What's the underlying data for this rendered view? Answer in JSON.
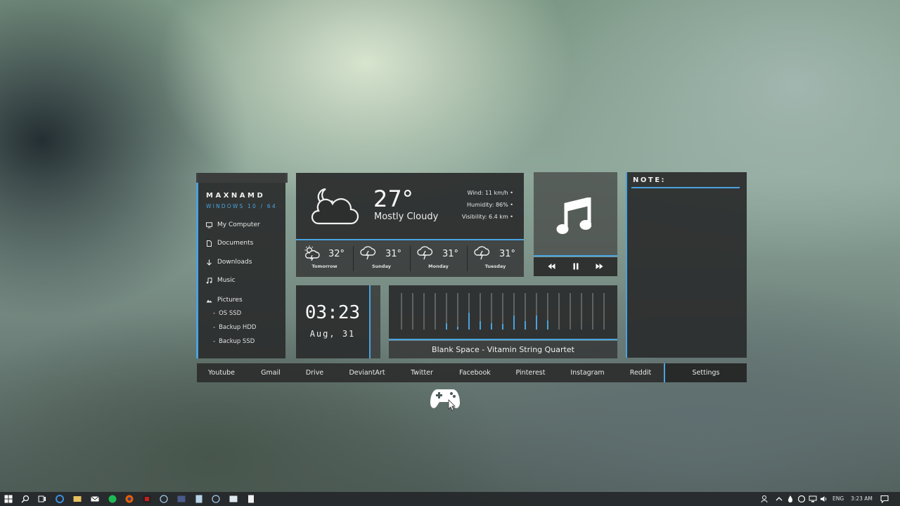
{
  "sidebar": {
    "brand": "MAXNAMD",
    "subtitle": "WINDOWS 10 / 64",
    "items": [
      {
        "label": "My Computer",
        "icon": "monitor-icon"
      },
      {
        "label": "Documents",
        "icon": "document-icon"
      },
      {
        "label": "Downloads",
        "icon": "download-arrow-icon"
      },
      {
        "label": "Music",
        "icon": "music-note-icon"
      },
      {
        "label": "Pictures",
        "icon": "picture-icon"
      }
    ],
    "subitems": [
      "OS SSD",
      "Backup HDD",
      "Backup SSD"
    ]
  },
  "weather": {
    "temp": "27°",
    "condition": "Mostly Cloudy",
    "wind": "Wind: 11 km/h",
    "humidity": "Humidity: 86%",
    "visibility": "Visibility: 6.4 km",
    "forecast": [
      {
        "day": "Tomorrow",
        "temp": "32°",
        "icon": "sun-thunderstorm-icon"
      },
      {
        "day": "Sunday",
        "temp": "31°",
        "icon": "thunderstorm-icon"
      },
      {
        "day": "Monday",
        "temp": "31°",
        "icon": "thunderstorm-icon"
      },
      {
        "day": "Tuesday",
        "temp": "31°",
        "icon": "thunderstorm-icon"
      }
    ]
  },
  "music": {
    "song": "Blank Space - Vitamin String Quartet",
    "levels": [
      0,
      0,
      0,
      0,
      0.17,
      0.08,
      0.46,
      0.23,
      0.17,
      0.15,
      0.38,
      0.23,
      0.38,
      0.25,
      0,
      0,
      0,
      0,
      0
    ]
  },
  "note": {
    "title": "NOTE:"
  },
  "clock": {
    "time": "03:23",
    "date": "Aug, 31"
  },
  "links": [
    "Youtube",
    "Gmail",
    "Drive",
    "DeviantArt",
    "Twitter",
    "Facebook",
    "Pinterest",
    "Instagram",
    "Reddit"
  ],
  "settings": "Settings",
  "taskbar": {
    "lang": "ENG",
    "time": "3:23 AM"
  },
  "colors": {
    "accent": "#4aa3df",
    "panel": "#2e3030"
  }
}
